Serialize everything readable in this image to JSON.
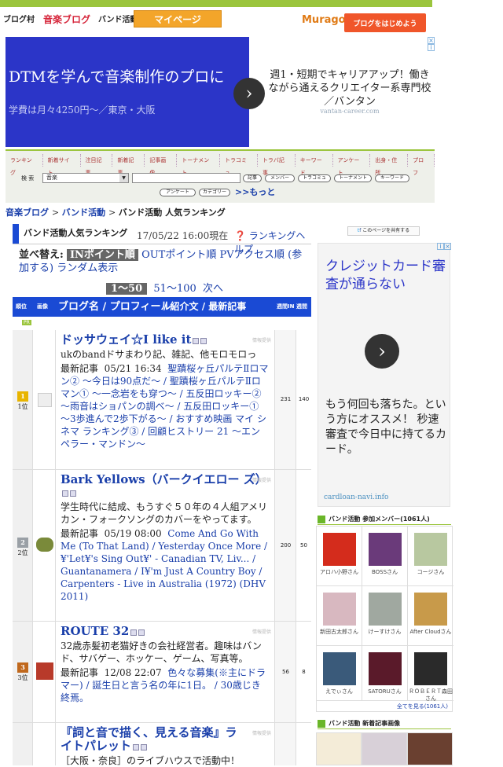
{
  "header": {
    "logos": [
      "ブログ村",
      "音楽ブログ",
      "バンド活動"
    ],
    "mypage_label": "マイページ",
    "muragon": "Muragon",
    "start_blog": "ブログをはじめよう"
  },
  "ad_banner": {
    "headline": "DTMを学んで音楽制作のプロに",
    "subline": "学費は月々4250円〜／東京・大阪",
    "right_text": "週1・短期でキャリアアップ！働きながら通えるクリエイター系専門校／バンタン",
    "url": "vantan-career.com"
  },
  "nav": {
    "tabs": [
      "ランキング",
      "新着サイト",
      "注目記事",
      "新着記事",
      "記事画像",
      "トーナメント",
      "トラコミュ",
      "トラバ記事",
      "キーワード",
      "アンケート",
      "出身・住所",
      "プロフ"
    ],
    "search_label": "検 索",
    "search_select": "音楽",
    "buttons_row1": [
      "記事",
      "メンバー",
      "トラコミュ",
      "トーナメント",
      "キーワード"
    ],
    "buttons_row2": [
      "アンケート",
      "カテゴリー"
    ],
    "more": ">>もっと"
  },
  "breadcrumb": [
    "音楽ブログ",
    "バンド活動",
    "バンド活動 人気ランキング"
  ],
  "ranking": {
    "title": "バンド活動人気ランキング",
    "date": "17/05/22 16:00現在",
    "help": "ランキングヘルプ",
    "sort_label": "並べ替え:",
    "sort_options": [
      "INポイント順",
      "OUTポイント順",
      "PVアクセス順 (参加する)",
      "ランダム表示"
    ],
    "pages": [
      "1〜50",
      "51〜100",
      "次へ"
    ],
    "columns": [
      "順位",
      "画像",
      "ブログ名 / プロフィール",
      "/ 紹介文 / 最新記事",
      "週間IN",
      "週間OUT"
    ],
    "pr": "PR",
    "entries": [
      {
        "rank": "1位",
        "title": "ドッサウェイ☆I like it",
        "desc": "ukのbandドサまわり記、雑記、他モロモロっ",
        "latest_label": "最新記事",
        "latest_date": "05/21 16:34",
        "articles": "聖蹟桜ヶ丘パルテⅡロマン② 〜今日は90点だ〜 / 聖蹟桜ヶ丘パルテⅡロマン① 〜一念岩をも穿つ〜 / 五反田ロッキー② 〜雨音はショパンの調べ〜 / 五反田ロッキー① 〜3歩進んで2歩下がる〜 / おすすめ映画 マイ シネマ ランキング③ / 回顧ヒストリー 21 〜エンペラー・マンドン〜",
        "in": "231",
        "out": "140"
      },
      {
        "rank": "2位",
        "title": "Bark Yellows（バークイエロー ズ）",
        "desc": "学生時代に結成、もうすぐ５０年の４人組アメリカン・フォークソングのカバーをやってます。",
        "latest_label": "最新記事",
        "latest_date": "05/19 08:00",
        "articles": "Come And Go With Me (To That Land) / Yesterday Once More / ¥'Let¥'s Sing Out¥' - Canadian TV, Liv... / Guantanamera / I¥'m Just A Country Boy / Carpenters - Live in Australia (1972) (DHV 2011)",
        "in": "200",
        "out": "50"
      },
      {
        "rank": "3位",
        "title": "ROUTE 32",
        "desc": "32歳赤髪初老猫好きの会社経営者。趣味はバンド、サバゲー、ホッケー、ゲーム、写真等。",
        "latest_label": "最新記事",
        "latest_date": "12/08 22:07",
        "articles": "色々な募集(※主にドラマー) / 誕生日と言う名の年に1日。 / 30歳じき終焉。",
        "in": "56",
        "out": "8"
      },
      {
        "rank": "",
        "title": "『詞と音で描く、見える音楽』ライトパレット",
        "desc": "［大阪・奈良］のライブハウスで活動中！",
        "latest_label": "",
        "latest_date": "",
        "articles": "",
        "in": "",
        "out": ""
      }
    ],
    "mini_label": "情報提供"
  },
  "sidebar": {
    "share": "このページを共有する",
    "ad": {
      "headline": "クレジットカード審査が通らない",
      "body": "もう何回も落ちた。という方にオススメ！ 秒速審査で今日中に持てるカード。",
      "url": "cardloan-navi.info"
    },
    "members_title": "バンド活動 参加メンバー(1061人)",
    "members": [
      "アロハ小野さん",
      "BOSSさん",
      "コージさん",
      "新田古太郎さん",
      "けーすけさん",
      "After Cloudさん",
      "えでぃさん",
      "SATORUさん",
      "ＲＯＢＥＲＴ森田さん"
    ],
    "see_all": "全てを見る(1061人)",
    "articles_title": "バンド活動 新着記事画像"
  }
}
